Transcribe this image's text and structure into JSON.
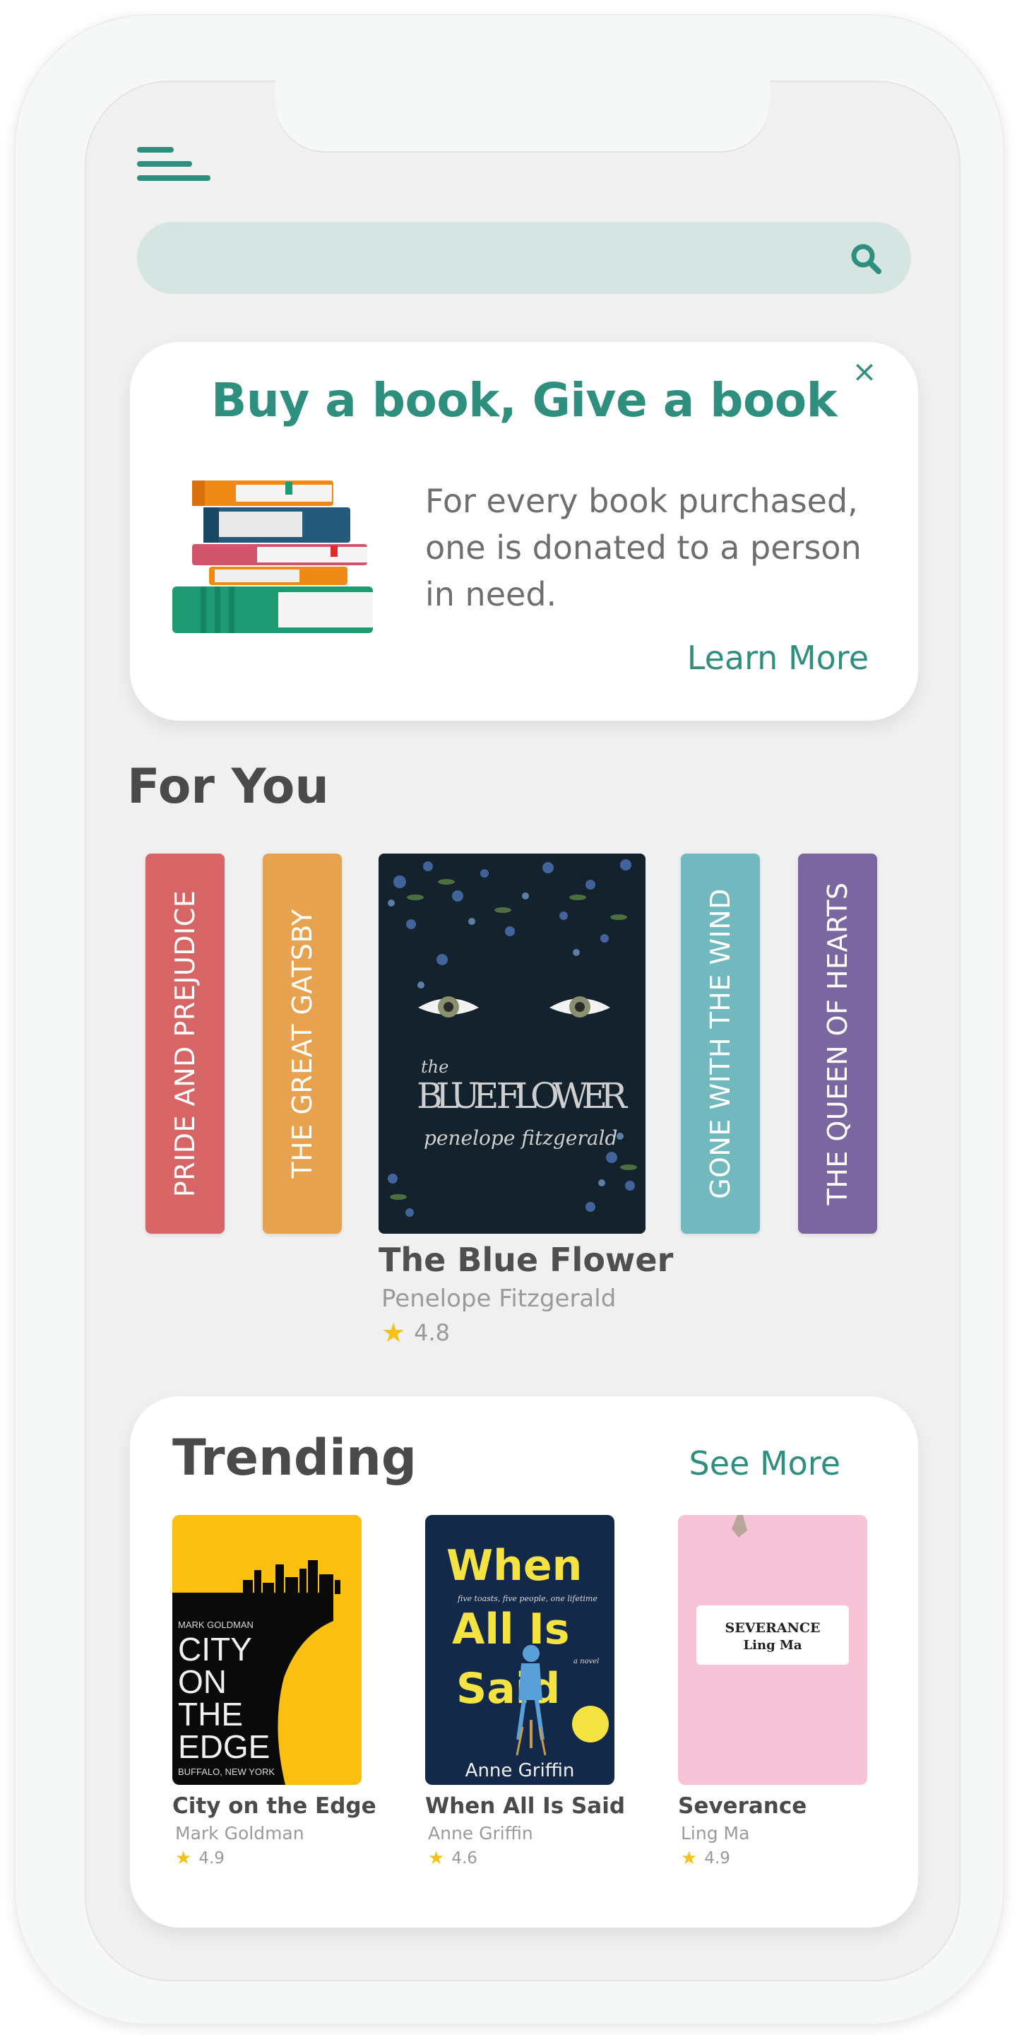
{
  "search": {
    "placeholder": ""
  },
  "promo": {
    "title": "Buy a book, Give a book",
    "body": "For every book purchased, one is donated to a person in need.",
    "link": "Learn More",
    "close": "×"
  },
  "for_you": {
    "title": "For You",
    "spines": [
      {
        "label": "PRIDE AND PREJUDICE",
        "color": "#d86566"
      },
      {
        "label": "THE GREAT GATSBY",
        "color": "#e7a24f"
      },
      {
        "label": "GONE WITH THE WIND",
        "color": "#72b8bf"
      },
      {
        "label": "THE QUEEN OF HEARTS",
        "color": "#7b67a0"
      }
    ],
    "featured": {
      "cover_small": "the",
      "cover_title": "BLUE FLOWER",
      "cover_author": "penelope fitzgerald",
      "title": "The Blue Flower",
      "author": "Penelope Fitzgerald",
      "rating": "4.8"
    }
  },
  "trending": {
    "title": "Trending",
    "see_more": "See More",
    "books": [
      {
        "title": "City on the Edge",
        "author": "Mark Goldman",
        "rating": "4.9",
        "cover": {
          "author": "MARK GOLDMAN",
          "lines": [
            "CITY",
            "ON",
            "THE",
            "EDGE"
          ],
          "subtitle": "BUFFALO, NEW YORK"
        }
      },
      {
        "title": "When All Is Said",
        "author": "Anne Griffin",
        "rating": "4.6",
        "cover": {
          "lines": [
            "When",
            "All Is",
            "Said"
          ],
          "tagline": "five toasts, five people, one lifetime",
          "novel": "a novel",
          "author": "Anne Griffin"
        }
      },
      {
        "title": "Severance",
        "author": "Ling Ma",
        "rating": "4.9",
        "cover": {
          "title": "SEVERANCE",
          "author": "Ling Ma"
        }
      }
    ]
  },
  "colors": {
    "accent": "#2f8f7f",
    "search_bg": "#d5e5e1",
    "star": "#f2c219"
  }
}
